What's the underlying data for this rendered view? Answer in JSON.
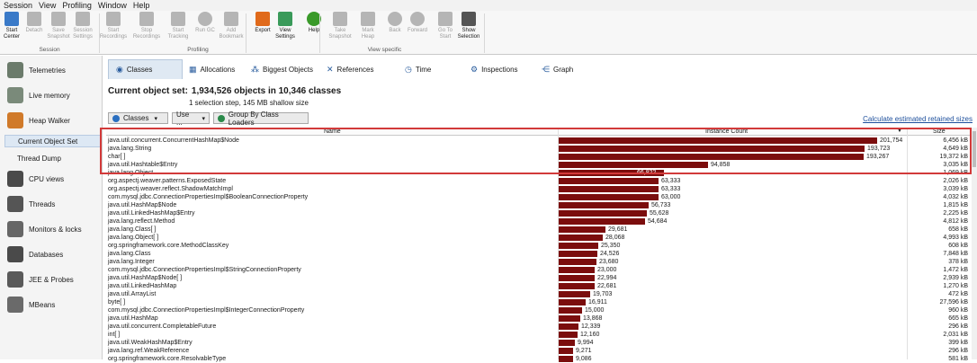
{
  "menu": [
    "Session",
    "View",
    "Profiling",
    "Window",
    "Help"
  ],
  "ribbon": {
    "buttons": [
      {
        "label": "Start\nCenter",
        "icon": "start-center-icon",
        "enabled": true,
        "color": "#3a7ac8"
      },
      {
        "label": "Detach",
        "icon": "detach-icon",
        "enabled": false,
        "color": "#b5b5b5"
      },
      {
        "label": "Save\nSnapshot",
        "icon": "save-icon",
        "enabled": false,
        "color": "#b5b5b5"
      },
      {
        "label": "Session\nSettings",
        "icon": "settings-icon",
        "enabled": false,
        "color": "#b5b5b5"
      },
      {
        "label": "Start\nRecordings",
        "icon": "record-icon",
        "enabled": false,
        "color": "#b5b5b5"
      },
      {
        "label": "Stop\nRecordings",
        "icon": "stop-record-icon",
        "enabled": false,
        "color": "#b5b5b5"
      },
      {
        "label": "Start\nTracking",
        "icon": "tracking-icon",
        "enabled": false,
        "color": "#b5b5b5"
      },
      {
        "label": "Run GC",
        "icon": "gc-icon",
        "enabled": false,
        "color": "#b5b5b5"
      },
      {
        "label": "Add\nBookmark",
        "icon": "bookmark-icon",
        "enabled": false,
        "color": "#b5b5b5"
      },
      {
        "label": "Export",
        "icon": "export-icon",
        "enabled": true,
        "color": "#e06a1b"
      },
      {
        "label": "View\nSettings",
        "icon": "view-settings-icon",
        "enabled": true,
        "color": "#3a9a5a"
      },
      {
        "label": "Help",
        "icon": "help-icon",
        "enabled": true,
        "color": "#3a9a2a"
      },
      {
        "label": "Take\nSnapshot",
        "icon": "camera-icon",
        "enabled": false,
        "color": "#b5b5b5"
      },
      {
        "label": "Mark\nHeap",
        "icon": "pin-icon",
        "enabled": false,
        "color": "#b5b5b5"
      },
      {
        "label": "Back",
        "icon": "back-icon",
        "enabled": false,
        "color": "#b5b5b5"
      },
      {
        "label": "Forward",
        "icon": "forward-icon",
        "enabled": false,
        "color": "#b5b5b5"
      },
      {
        "label": "Go To\nStart",
        "icon": "home-icon",
        "enabled": false,
        "color": "#b5b5b5"
      },
      {
        "label": "Show\nSelection",
        "icon": "selection-icon",
        "enabled": true,
        "color": "#555555"
      }
    ],
    "groups": [
      "Session",
      "Profiling",
      "View specific"
    ]
  },
  "sidebar": {
    "items": [
      {
        "label": "Telemetries",
        "icon": "telemetries-icon",
        "color": "#6b7b6b"
      },
      {
        "label": "Live memory",
        "icon": "live-memory-icon",
        "color": "#7a8a7a"
      },
      {
        "label": "Heap Walker",
        "icon": "heap-walker-icon",
        "color": "#d07a2a"
      },
      {
        "label": "CPU views",
        "icon": "cpu-views-icon",
        "color": "#4a4a4a"
      },
      {
        "label": "Threads",
        "icon": "threads-icon",
        "color": "#555555"
      },
      {
        "label": "Monitors & locks",
        "icon": "lock-icon",
        "color": "#666666"
      },
      {
        "label": "Databases",
        "icon": "database-icon",
        "color": "#4a4a4a"
      },
      {
        "label": "JEE & Probes",
        "icon": "probe-icon",
        "color": "#5a5a5a"
      },
      {
        "label": "MBeans",
        "icon": "mbeans-icon",
        "color": "#6a6a6a"
      }
    ],
    "subitems": [
      "Current Object Set",
      "Thread Dump"
    ]
  },
  "tabs": [
    {
      "label": "Classes",
      "icon": "classes-icon",
      "glyph": "◉"
    },
    {
      "label": "Allocations",
      "icon": "allocations-icon",
      "glyph": "▦"
    },
    {
      "label": "Biggest Objects",
      "icon": "biggest-objects-icon",
      "glyph": "⁂"
    },
    {
      "label": "References",
      "icon": "references-icon",
      "glyph": "✕"
    },
    {
      "label": "Time",
      "icon": "time-icon",
      "glyph": "◷"
    },
    {
      "label": "Inspections",
      "icon": "inspections-icon",
      "glyph": "⚙"
    },
    {
      "label": "Graph",
      "icon": "graph-icon",
      "glyph": "⋲"
    }
  ],
  "objectset": {
    "title": "Current object set:",
    "summary": "1,934,526 objects in 10,346 classes",
    "sub": "1 selection step, 145 MB shallow size"
  },
  "controls": {
    "view_select": "Classes",
    "use_label": "Use ...",
    "group_label": "Group By Class Loaders",
    "calc_link": "Calculate estimated retained sizes"
  },
  "table": {
    "headers": {
      "name": "Name",
      "count": "Instance Count",
      "size": "Size"
    },
    "max_count": 201754,
    "bar_color": "#7b0d0d",
    "highlight_color": "#d23a3a",
    "rows": [
      {
        "name": "java.util.concurrent.ConcurrentHashMap$Node",
        "count": 201754,
        "count_label": "201,754",
        "size": "6,456 kB"
      },
      {
        "name": "java.lang.String",
        "count": 193723,
        "count_label": "193,723",
        "size": "4,649 kB"
      },
      {
        "name": "char[ ]",
        "count": 193267,
        "count_label": "193,267",
        "size": "19,372 kB"
      },
      {
        "name": "java.util.Hashtable$Entry",
        "count": 94858,
        "count_label": "94,858",
        "size": "3,035 kB"
      },
      {
        "name": "java.lang.Object",
        "count": 66822,
        "count_label": "66,822",
        "size": "1,069 kB"
      },
      {
        "name": "org.aspectj.weaver.patterns.ExposedState",
        "count": 63333,
        "count_label": "63,333",
        "size": "2,026 kB"
      },
      {
        "name": "org.aspectj.weaver.reflect.ShadowMatchImpl",
        "count": 63333,
        "count_label": "63,333",
        "size": "3,039 kB"
      },
      {
        "name": "com.mysql.jdbc.ConnectionPropertiesImpl$BooleanConnectionProperty",
        "count": 63000,
        "count_label": "63,000",
        "size": "4,032 kB"
      },
      {
        "name": "java.util.HashMap$Node",
        "count": 56733,
        "count_label": "56,733",
        "size": "1,815 kB"
      },
      {
        "name": "java.util.LinkedHashMap$Entry",
        "count": 55628,
        "count_label": "55,628",
        "size": "2,225 kB"
      },
      {
        "name": "java.lang.reflect.Method",
        "count": 54684,
        "count_label": "54,684",
        "size": "4,812 kB"
      },
      {
        "name": "java.lang.Class[ ]",
        "count": 29681,
        "count_label": "29,681",
        "size": "658 kB"
      },
      {
        "name": "java.lang.Object[ ]",
        "count": 28068,
        "count_label": "28,068",
        "size": "4,993 kB"
      },
      {
        "name": "org.springframework.core.MethodClassKey",
        "count": 25350,
        "count_label": "25,350",
        "size": "608 kB"
      },
      {
        "name": "java.lang.Class",
        "count": 24526,
        "count_label": "24,526",
        "size": "7,848 kB"
      },
      {
        "name": "java.lang.Integer",
        "count": 23680,
        "count_label": "23,680",
        "size": "378 kB"
      },
      {
        "name": "com.mysql.jdbc.ConnectionPropertiesImpl$StringConnectionProperty",
        "count": 23000,
        "count_label": "23,000",
        "size": "1,472 kB"
      },
      {
        "name": "java.util.HashMap$Node[ ]",
        "count": 22994,
        "count_label": "22,994",
        "size": "2,939 kB"
      },
      {
        "name": "java.util.LinkedHashMap",
        "count": 22681,
        "count_label": "22,681",
        "size": "1,270 kB"
      },
      {
        "name": "java.util.ArrayList",
        "count": 19703,
        "count_label": "19,703",
        "size": "472 kB"
      },
      {
        "name": "byte[ ]",
        "count": 16911,
        "count_label": "16,911",
        "size": "27,596 kB"
      },
      {
        "name": "com.mysql.jdbc.ConnectionPropertiesImpl$IntegerConnectionProperty",
        "count": 15000,
        "count_label": "15,000",
        "size": "960 kB"
      },
      {
        "name": "java.util.HashMap",
        "count": 13868,
        "count_label": "13,868",
        "size": "665 kB"
      },
      {
        "name": "java.util.concurrent.CompletableFuture",
        "count": 12339,
        "count_label": "12,339",
        "size": "296 kB"
      },
      {
        "name": "int[ ]",
        "count": 12160,
        "count_label": "12,160",
        "size": "2,031 kB"
      },
      {
        "name": "java.util.WeakHashMap$Entry",
        "count": 9994,
        "count_label": "9,994",
        "size": "399 kB"
      },
      {
        "name": "java.lang.ref.WeakReference",
        "count": 9271,
        "count_label": "9,271",
        "size": "296 kB"
      },
      {
        "name": "org.springframework.core.ResolvableType",
        "count": 9086,
        "count_label": "9,086",
        "size": "581 kB"
      }
    ]
  }
}
